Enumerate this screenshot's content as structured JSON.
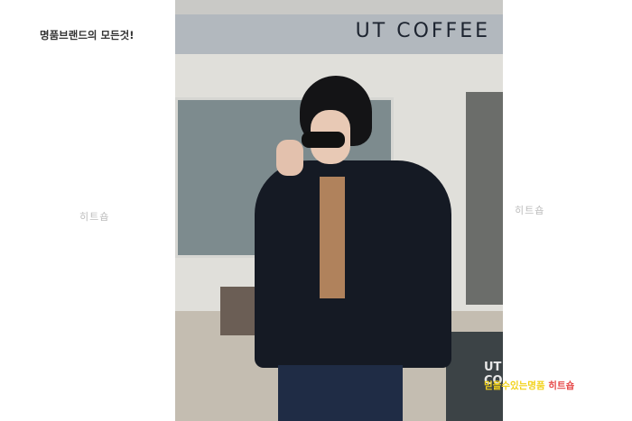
{
  "header": {
    "tagline": "명품브랜드의 모든것!"
  },
  "watermarks": {
    "left": "히트숍",
    "right": "히트숍"
  },
  "photo": {
    "sign_text": "UT COFFEE",
    "board_text": "UT COFF"
  },
  "footer": {
    "slogan": "믿을수있는명품",
    "brand": "히트숍"
  },
  "colors": {
    "slogan_color": "#f2d21b",
    "brand_color": "#e64848"
  }
}
